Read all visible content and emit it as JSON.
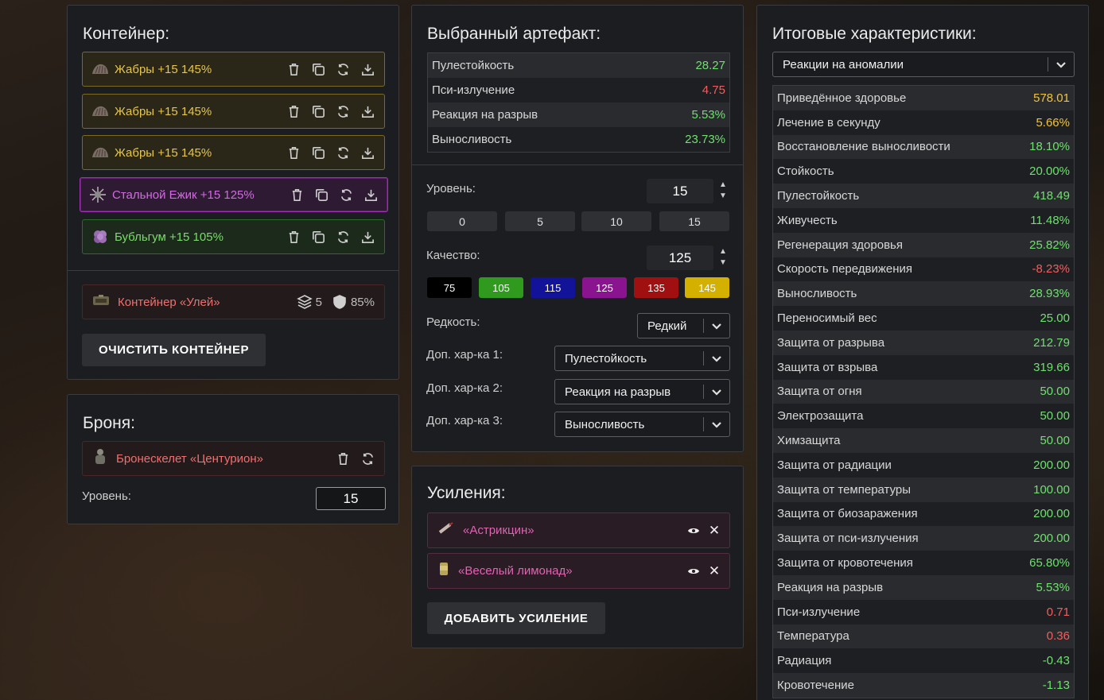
{
  "container": {
    "title": "Контейнер:",
    "slots": [
      {
        "label": "Жабры +15 145%"
      },
      {
        "label": "Жабры +15 145%"
      },
      {
        "label": "Жабры +15 145%"
      },
      {
        "label": "Стальной Ежик +15 125%"
      },
      {
        "label": "Бубльгум +15 105%"
      }
    ],
    "container_name": "Контейнер «Улей»",
    "slots_count": "5",
    "protection": "85%",
    "clear_label": "ОЧИСТИТЬ КОНТЕЙНЕР"
  },
  "armor": {
    "title": "Броня:",
    "name": "Бронескелет «Центурион»",
    "level_label": "Уровень:",
    "level_value": "15"
  },
  "selected": {
    "title": "Выбранный артефакт:",
    "stats": [
      {
        "name": "Пулестойкость",
        "value": "28.27",
        "color": "green"
      },
      {
        "name": "Пси-излучение",
        "value": "4.75",
        "color": "red"
      },
      {
        "name": "Реакция на разрыв",
        "value": "5.53%",
        "color": "green"
      },
      {
        "name": "Выносливость",
        "value": "23.73%",
        "color": "green"
      }
    ],
    "level_label": "Уровень:",
    "level_value": "15",
    "level_buttons": [
      "0",
      "5",
      "10",
      "15"
    ],
    "quality_label": "Качество:",
    "quality_value": "125",
    "quality_buttons": [
      {
        "label": "75",
        "color": "#000000"
      },
      {
        "label": "105",
        "color": "#2f9a1e"
      },
      {
        "label": "115",
        "color": "#13139a"
      },
      {
        "label": "125",
        "color": "#8a138f"
      },
      {
        "label": "135",
        "color": "#a01010"
      },
      {
        "label": "145",
        "color": "#d4b100"
      }
    ],
    "rarity_label": "Редкость:",
    "rarity_value": "Редкий",
    "extra1_label": "Доп. хар-ка 1:",
    "extra1_value": "Пулестойкость",
    "extra2_label": "Доп. хар-ка 2:",
    "extra2_value": "Реакция на разрыв",
    "extra3_label": "Доп. хар-ка 3:",
    "extra3_value": "Выносливость"
  },
  "boosts": {
    "title": "Усиления:",
    "items": [
      {
        "name": "«Астрикцин»"
      },
      {
        "name": "«Веселый лимонад»"
      }
    ],
    "add_label": "ДОБАВИТЬ УСИЛЕНИЕ"
  },
  "summary": {
    "title": "Итоговые характеристики:",
    "filter_value": "Реакции на аномалии",
    "stats": [
      {
        "name": "Приведённое здоровье",
        "value": "578.01",
        "color": "gold"
      },
      {
        "name": "Лечение в секунду",
        "value": "5.66%",
        "color": "gold"
      },
      {
        "name": "Восстановление выносливости",
        "value": "18.10%",
        "color": "green"
      },
      {
        "name": "Стойкость",
        "value": "20.00%",
        "color": "green"
      },
      {
        "name": "Пулестойкость",
        "value": "418.49",
        "color": "green"
      },
      {
        "name": "Живучесть",
        "value": "11.48%",
        "color": "green"
      },
      {
        "name": "Регенерация здоровья",
        "value": "25.82%",
        "color": "green"
      },
      {
        "name": "Скорость передвижения",
        "value": "-8.23%",
        "color": "red"
      },
      {
        "name": "Выносливость",
        "value": "28.93%",
        "color": "green"
      },
      {
        "name": "Переносимый вес",
        "value": "25.00",
        "color": "green"
      },
      {
        "name": "Защита от разрыва",
        "value": "212.79",
        "color": "green"
      },
      {
        "name": "Защита от взрыва",
        "value": "319.66",
        "color": "green"
      },
      {
        "name": "Защита от огня",
        "value": "50.00",
        "color": "green"
      },
      {
        "name": "Электрозащита",
        "value": "50.00",
        "color": "green"
      },
      {
        "name": "Химзащита",
        "value": "50.00",
        "color": "green"
      },
      {
        "name": "Защита от радиации",
        "value": "200.00",
        "color": "green"
      },
      {
        "name": "Защита от температуры",
        "value": "100.00",
        "color": "green"
      },
      {
        "name": "Защита от биозаражения",
        "value": "200.00",
        "color": "green"
      },
      {
        "name": "Защита от пси-излучения",
        "value": "200.00",
        "color": "green"
      },
      {
        "name": "Защита от кровотечения",
        "value": "65.80%",
        "color": "green"
      },
      {
        "name": "Реакция на разрыв",
        "value": "5.53%",
        "color": "green"
      },
      {
        "name": "Пси-излучение",
        "value": "0.71",
        "color": "red"
      },
      {
        "name": "Температура",
        "value": "0.36",
        "color": "red"
      },
      {
        "name": "Радиация",
        "value": "-0.43",
        "color": "green"
      },
      {
        "name": "Кровотечение",
        "value": "-1.13",
        "color": "green"
      }
    ]
  }
}
